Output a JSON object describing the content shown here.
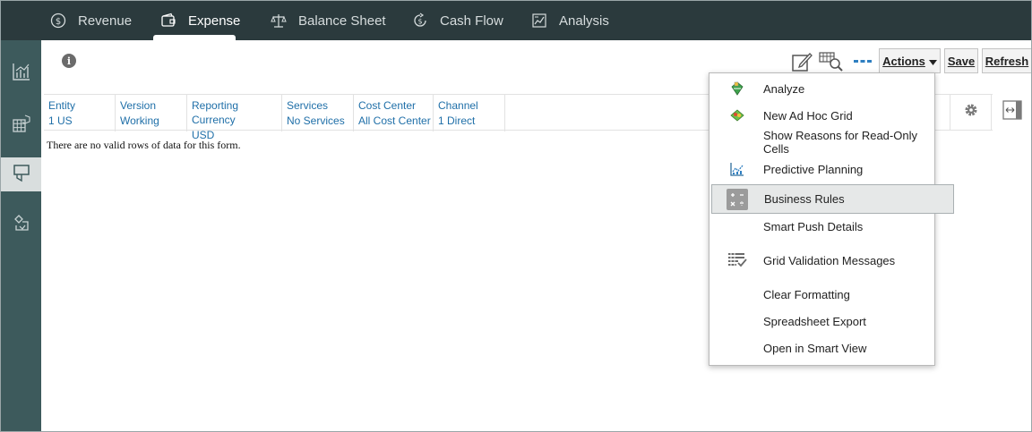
{
  "nav": {
    "tabs": [
      {
        "label": "Revenue",
        "icon": "dollar-circle-icon"
      },
      {
        "label": "Expense",
        "icon": "wallet-icon",
        "active": true
      },
      {
        "label": "Balance Sheet",
        "icon": "scale-icon"
      },
      {
        "label": "Cash Flow",
        "icon": "dollar-cycle-icon"
      },
      {
        "label": "Analysis",
        "icon": "report-chart-icon"
      }
    ]
  },
  "rail": {
    "items": [
      {
        "icon": "bar-chart-icon"
      },
      {
        "icon": "grid-cube-icon"
      },
      {
        "icon": "form-icon",
        "active": true
      },
      {
        "icon": "rules-icon"
      }
    ]
  },
  "toolbar": {
    "actions_label": "Actions",
    "save_label": "Save",
    "refresh_label": "Refresh"
  },
  "pov": {
    "cells": [
      {
        "label": "Entity",
        "value": "1 US"
      },
      {
        "label": "Version",
        "value": "Working"
      },
      {
        "label": "Reporting Currency",
        "value": "USD"
      },
      {
        "label": "Services",
        "value": "No Services"
      },
      {
        "label": "Cost Center",
        "value": "All Cost Center"
      },
      {
        "label": "Channel",
        "value": "1 Direct"
      }
    ]
  },
  "grid": {
    "empty_message": "There are no valid rows of data for this form."
  },
  "actions_menu": {
    "items": [
      {
        "label": "Analyze",
        "icon": "analyze-icon"
      },
      {
        "label": "New Ad Hoc Grid",
        "icon": "adhoc-grid-icon"
      },
      {
        "label": "Show Reasons for Read-Only Cells",
        "icon": ""
      },
      {
        "label": "Predictive Planning",
        "icon": "predictive-chart-icon"
      },
      {
        "label": "Business Rules",
        "icon": "calculator-icon",
        "highlighted": true
      },
      {
        "label": "Smart Push Details",
        "icon": ""
      },
      {
        "label": "Grid Validation Messages",
        "icon": "grid-check-icon"
      },
      {
        "label": "Clear Formatting",
        "icon": ""
      },
      {
        "label": "Spreadsheet Export",
        "icon": ""
      },
      {
        "label": "Open in Smart View",
        "icon": ""
      }
    ]
  },
  "colors": {
    "topbar": "#2b3a3d",
    "rail": "#3d5a5c",
    "link": "#1f6fa8",
    "highlight": "#e6e8e8"
  }
}
